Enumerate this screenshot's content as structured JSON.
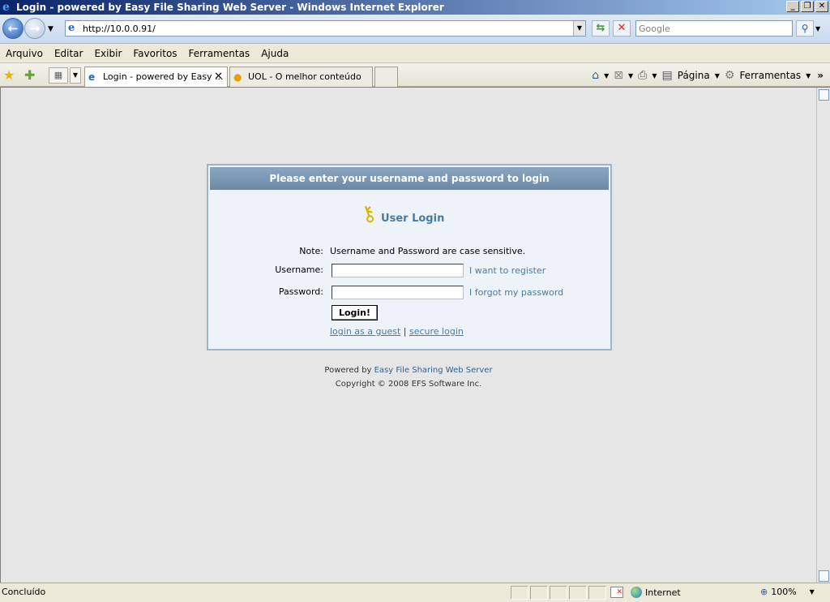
{
  "window": {
    "title": "Login - powered by Easy File Sharing Web Server - Windows Internet Explorer"
  },
  "address_bar": {
    "url": "http://10.0.0.91/",
    "search_placeholder": "Google"
  },
  "menu": {
    "items": [
      "Arquivo",
      "Editar",
      "Exibir",
      "Favoritos",
      "Ferramentas",
      "Ajuda"
    ]
  },
  "tabs": [
    {
      "label": "Login - powered by Easy ...",
      "active": true
    },
    {
      "label": "UOL - O melhor conteúdo",
      "active": false
    }
  ],
  "commands": {
    "page_label": "Página",
    "tools_label": "Ferramentas"
  },
  "login": {
    "header": "Please enter your username and password to login",
    "title": "User Login",
    "note_label": "Note:",
    "note_text": "Username and Password are case sensitive.",
    "username_label": "Username:",
    "password_label": "Password:",
    "register_link": "I want to register",
    "forgot_link": "I forgot my password",
    "login_button": "Login!",
    "guest_link": "login as a guest",
    "separator": "|",
    "secure_link": "secure login"
  },
  "footer": {
    "powered_by": "Powered by",
    "powered_link": "Easy File Sharing Web Server",
    "copyright": "Copyright © 2008 EFS Software Inc."
  },
  "status": {
    "text": "Concluído",
    "zone": "Internet",
    "zoom": "100%"
  },
  "colors": {
    "panel_header": "#7b98b4",
    "panel_bg": "#eef3f9",
    "link": "#4a7aa0",
    "page_bg": "#e6e6e6"
  }
}
